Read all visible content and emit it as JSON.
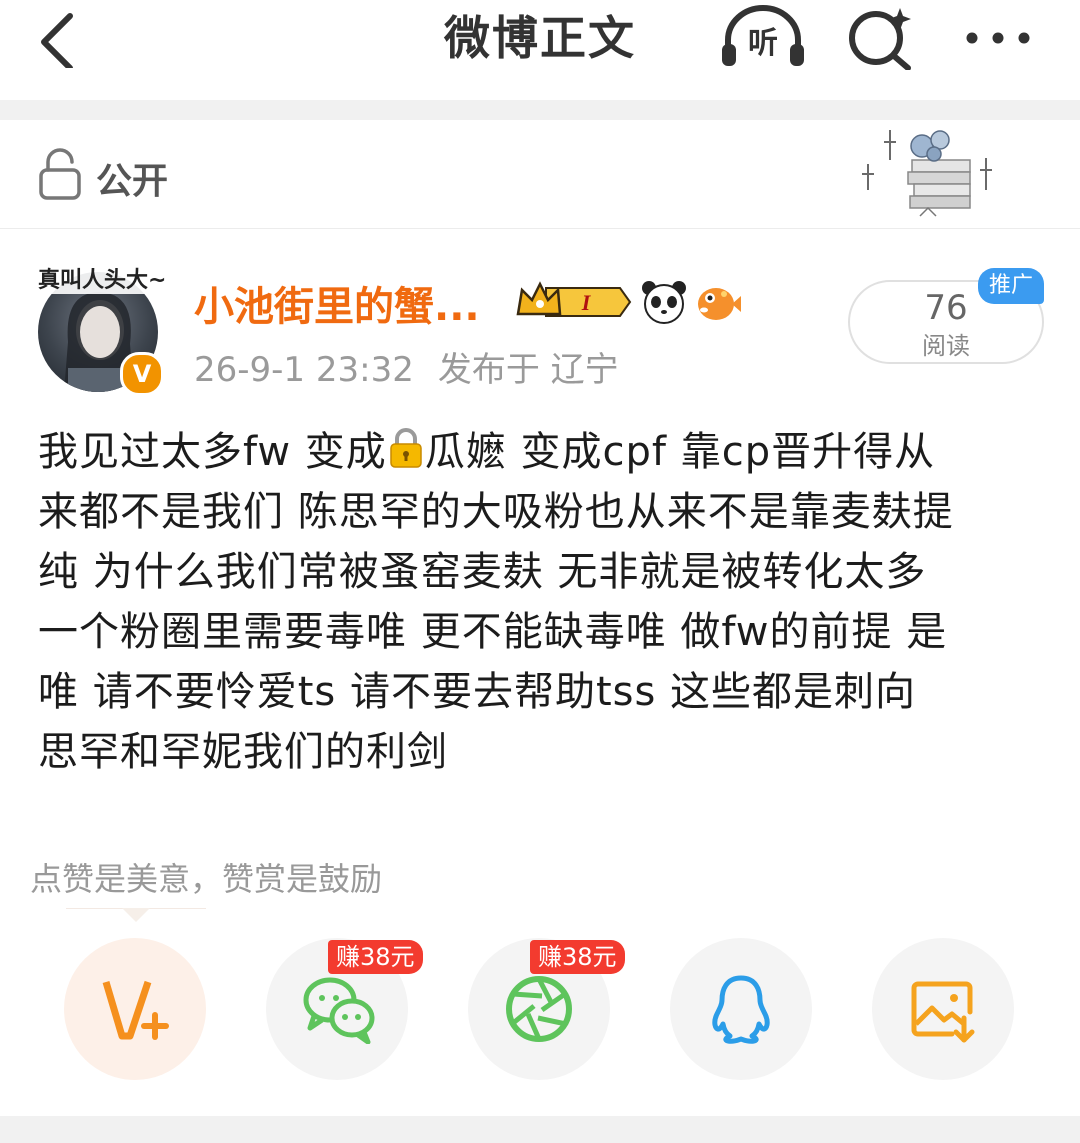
{
  "nav": {
    "title": "微博正文",
    "listen_label": "听",
    "back_icon": "chevron-left-icon",
    "search_icon": "ai-search-icon",
    "more_icon": "more-dots-icon"
  },
  "visibility": {
    "label": "公开",
    "icon": "unlock-icon"
  },
  "author": {
    "name": "小池街里的蟹...",
    "avatar_caption": "真叫人头大~",
    "verified_badge": "V",
    "member_badge_letter": "I",
    "badges": [
      "crown-member-badge",
      "panda-badge",
      "pufferfish-badge"
    ]
  },
  "post": {
    "date": "26-9-1 23:32",
    "location": "发布于 辽宁",
    "read_count": "76",
    "read_label": "阅读",
    "promo_label": "推广",
    "lines": [
      "我见过太多fw 变成",
      "瓜嬷 变成cpf 靠cp晋升得从",
      "来都不是我们 陈思罕的大吸粉也从来不是靠麦麸提",
      "纯 为什么我们常被蚤窑麦麸 无非就是被转化太多",
      "一个粉圈里需要毒唯 更不能缺毒唯 做fw的前提 是",
      "唯 请不要怜爱ts 请不要去帮助tss 这些都是刺向",
      "思罕和罕妮我们的利剑"
    ]
  },
  "appreciation": {
    "hint": "点赞是美意，赞赏是鼓励",
    "wechat_earn": "赚38元",
    "moments_earn": "赚38元"
  },
  "colors": {
    "accent_orange": "#f06a10",
    "promo_blue": "#3b9bf0",
    "earn_red": "#f33b2f",
    "qq_blue": "#2b9de8",
    "wechat_green": "#5ec45c"
  }
}
